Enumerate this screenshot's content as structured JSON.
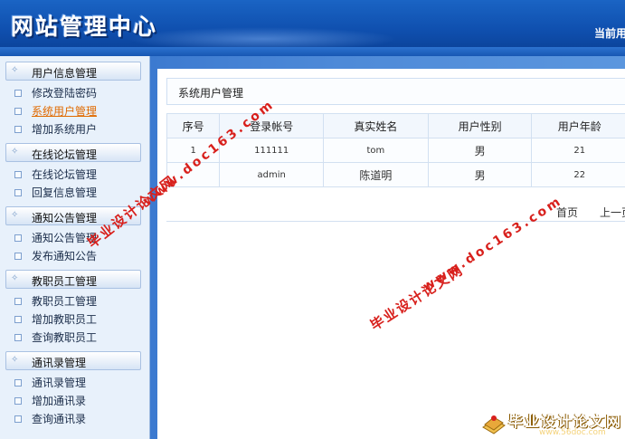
{
  "header": {
    "site_title": "网站管理中心",
    "current_user_label": "当前用"
  },
  "sidebar": {
    "groups": [
      {
        "title": "用户信息管理",
        "links": [
          "修改登陆密码",
          "系统用户管理",
          "增加系统用户"
        ]
      },
      {
        "title": "在线论坛管理",
        "links": [
          "在线论坛管理",
          "回复信息管理"
        ]
      },
      {
        "title": "通知公告管理",
        "links": [
          "通知公告管理",
          "发布通知公告"
        ]
      },
      {
        "title": "教职员工管理",
        "links": [
          "教职员工管理",
          "增加教职员工",
          "查询教职员工"
        ]
      },
      {
        "title": "通讯录管理",
        "links": [
          "通讯录管理",
          "增加通讯录",
          "查询通讯录"
        ]
      }
    ],
    "active_link": "系统用户管理"
  },
  "main": {
    "panel_title": "系统用户管理",
    "table": {
      "columns": [
        "序号",
        "登录帐号",
        "真实姓名",
        "用户性别",
        "用户年龄"
      ],
      "rows": [
        [
          "1",
          "111111",
          "tom",
          "男",
          "21"
        ],
        [
          "",
          "admin",
          "陈道明",
          "男",
          "22"
        ]
      ]
    },
    "pager": {
      "first": "首页",
      "prev": "上一页"
    }
  },
  "watermarks": {
    "site_name": "毕业设计论文网",
    "url": "www.doc163.com",
    "logo_name": "毕业设计论文网",
    "logo_url": "www.56doc.com"
  },
  "colors": {
    "header_blue": "#0f4fae",
    "sidebar_bg": "#e8f1fb",
    "active_link": "#e06a00",
    "watermark_red": "#d8201c"
  }
}
